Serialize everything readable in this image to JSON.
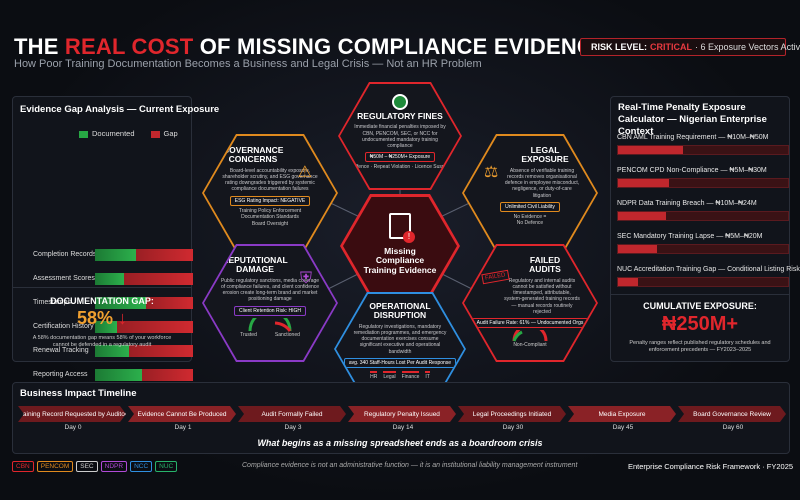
{
  "header": {
    "title_pre": "THE ",
    "title_hl": "REAL COST",
    "title_post": " OF MISSING COMPLIANCE EVIDENCE",
    "subtitle": "How Poor Training Documentation Becomes a Business and Legal Crisis — Not an HR Problem",
    "risk_label": "RISK LEVEL:",
    "risk_value": "CRITICAL",
    "risk_rest": "· 6 Exposure Vectors Active"
  },
  "gap_analysis": {
    "title": "Evidence Gap Analysis — Current Exposure",
    "legend_documented": "Documented",
    "legend_gap": "Gap",
    "rows": [
      {
        "label": "Completion Records",
        "documented": 42
      },
      {
        "label": "Assessment Scores",
        "documented": 30
      },
      {
        "label": "Timestamps",
        "documented": 52
      },
      {
        "label": "Certification History",
        "documented": 22
      },
      {
        "label": "Renewal Tracking",
        "documented": 35
      },
      {
        "label": "Reporting Access",
        "documented": 48
      }
    ],
    "gap_label": "DOCUMENTATION GAP:",
    "gap_value": "58%",
    "gap_arrow": "↓",
    "gap_note": "A 58% documentation gap means 58% of your workforce cannot be defended in a regulatory audit"
  },
  "center": {
    "title": "Missing Compliance Training Evidence"
  },
  "hexes": {
    "fines": {
      "title": "REGULATORY FINES",
      "desc": "Immediate financial penalties imposed by CBN, PENCOM, SEC, or NCC for undocumented mandatory training compliance",
      "pill": "₦50M – ₦250M+ Exposure",
      "note": "First Offence · Repeat Violation · Licence Suspension"
    },
    "governance": {
      "title": "GOVERNANCE CONCERNS",
      "desc": "Board-level accountability exposure, shareholder scrutiny, and ESG governance rating downgrades triggered by systemic compliance documentation failures",
      "pill": "ESG Rating Impact: NEGATIVE",
      "items": [
        "Training Policy Enforcement",
        "Documentation Standards",
        "Board Oversight"
      ]
    },
    "legal": {
      "title": "LEGAL EXPOSURE",
      "desc": "Absence of verifiable training records removes organisational defence in employee misconduct, negligence, or duty-of-care litigation",
      "pill": "Unlimited Civil Liability",
      "items": [
        "No Evidence =",
        "No Defence"
      ]
    },
    "reputational": {
      "title": "REPUTATIONAL DAMAGE",
      "desc": "Public regulatory sanctions, media coverage of compliance failures, and client confidence erosion create long-term brand and market positioning damage",
      "pill": "Client Retention Risk: HIGH",
      "gauge_left": "Trusted",
      "gauge_right": "Sanctioned"
    },
    "audits": {
      "title": "FAILED AUDITS",
      "desc": "Regulatory and internal audits cannot be satisfied without timestamped, attributable, system-generated training records — manual records routinely rejected",
      "stamp": "FAILED",
      "pill": "Audit Failure Rate: 61% — Undocumented Orgs",
      "gauge_label": "Non-Compliant"
    },
    "operational": {
      "title": "OPERATIONAL DISRUPTION",
      "desc": "Regulatory investigations, mandatory remediation programmes, and emergency documentation exercises consume significant executive and operational bandwidth",
      "pill": "avg. 340 Staff-Hours Lost Per Audit Response",
      "depts": [
        "HR",
        "Legal",
        "Finance",
        "IT"
      ]
    }
  },
  "calculator": {
    "title": "Real-Time Penalty Exposure Calculator — Nigerian Enterprise Context",
    "rows": [
      {
        "label": "CBN AML Training Requirement — ₦10M–₦50M",
        "fill": 0.38
      },
      {
        "label": "PENCOM CPD Non-Compliance — ₦5M–₦30M",
        "fill": 0.3
      },
      {
        "label": "NDPR Data Training Breach — ₦10M–₦24M",
        "fill": 0.28
      },
      {
        "label": "SEC Mandatory Training Lapse — ₦5M–₦20M",
        "fill": 0.23
      },
      {
        "label": "NUC Accreditation Training Gap — Conditional Listing Risk",
        "fill": 0.12
      }
    ],
    "cumulative_label": "CUMULATIVE EXPOSURE:",
    "cumulative_value": "₦250M+",
    "note": "Penalty ranges reflect published regulatory schedules and enforcement precedents — FY2023–2025"
  },
  "timeline": {
    "title": "Business Impact Timeline",
    "steps": [
      {
        "label": "Training Record Requested by Auditor",
        "day": "Day 0"
      },
      {
        "label": "Evidence Cannot Be Produced",
        "day": "Day 1"
      },
      {
        "label": "Audit Formally Failed",
        "day": "Day 3"
      },
      {
        "label": "Regulatory Penalty Issued",
        "day": "Day 14"
      },
      {
        "label": "Legal Proceedings Initiated",
        "day": "Day 30"
      },
      {
        "label": "Media Exposure",
        "day": "Day 45"
      },
      {
        "label": "Board Governance Review",
        "day": "Day 60"
      }
    ],
    "tagline": "What begins as a missing spreadsheet ends as a boardroom crisis"
  },
  "footer": {
    "chips": [
      {
        "label": "CBN",
        "color": "#e0262c"
      },
      {
        "label": "PENCOM",
        "color": "#e08a1e"
      },
      {
        "label": "SEC",
        "color": "#cccccc"
      },
      {
        "label": "NDPR",
        "color": "#b04ad6"
      },
      {
        "label": "NCC",
        "color": "#2f8fe0"
      },
      {
        "label": "NUC",
        "color": "#27b36a"
      }
    ],
    "note": "Compliance evidence is not an administrative function — it is an institutional liability management instrument",
    "framework": "Enterprise Compliance Risk Framework · FY2025"
  },
  "colors": {
    "documented": "#27a844",
    "gap": "#c0272d",
    "accent": "#e0262c"
  }
}
